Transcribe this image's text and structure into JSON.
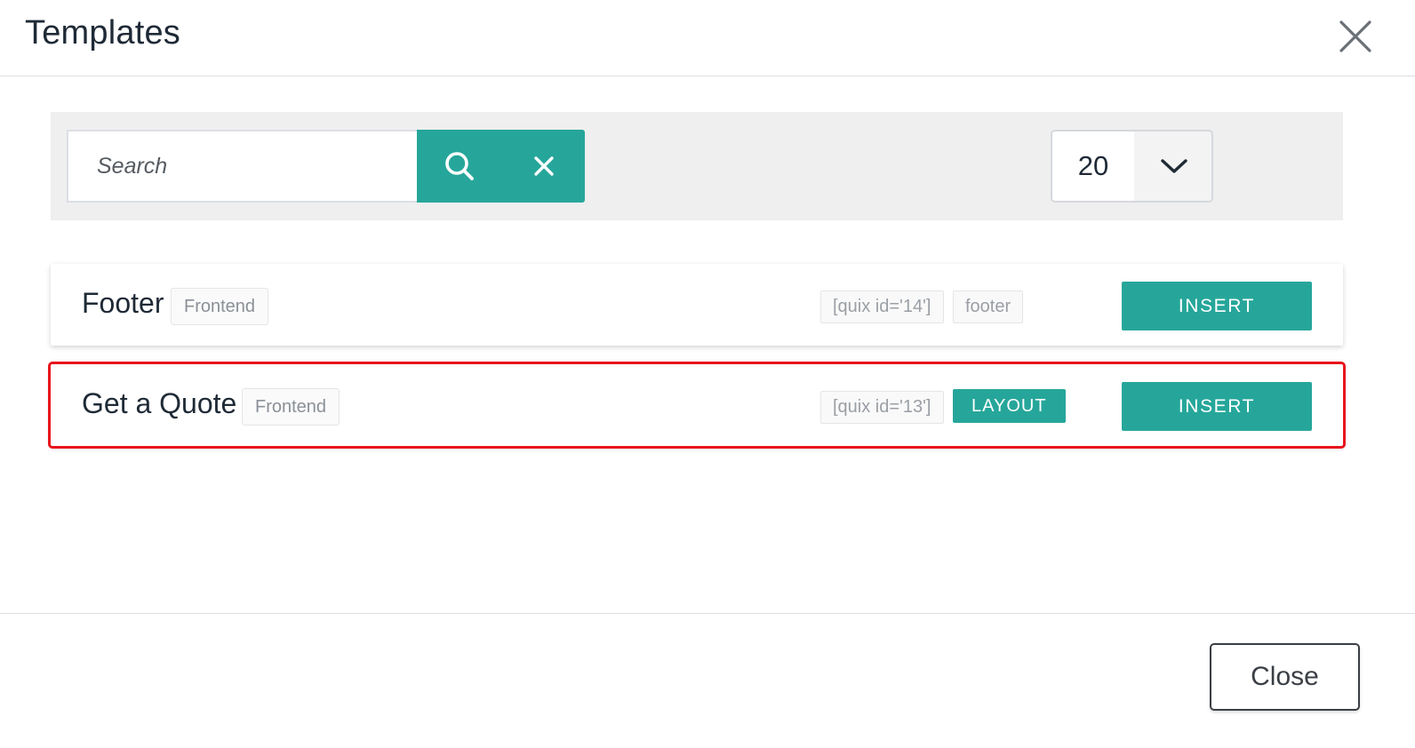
{
  "header": {
    "title": "Templates",
    "close_icon": "close-icon"
  },
  "toolbar": {
    "search_placeholder": "Search",
    "search_value": "",
    "search_icon": "search-icon",
    "clear_icon": "close-icon",
    "page_size": "20",
    "page_size_icon": "chevron-down-icon"
  },
  "templates": [
    {
      "name": "Footer",
      "type": "Frontend",
      "shortcode": "[quix id='14']",
      "label": "footer",
      "badge": "",
      "insert_label": "INSERT",
      "highlighted": false
    },
    {
      "name": "Get a Quote",
      "type": "Frontend",
      "shortcode": "[quix id='13']",
      "label": "",
      "badge": "LAYOUT",
      "insert_label": "INSERT",
      "highlighted": true
    }
  ],
  "footer": {
    "close_label": "Close"
  },
  "colors": {
    "accent": "#26a69a",
    "highlight": "#e8141b",
    "text": "#1f2a36"
  }
}
